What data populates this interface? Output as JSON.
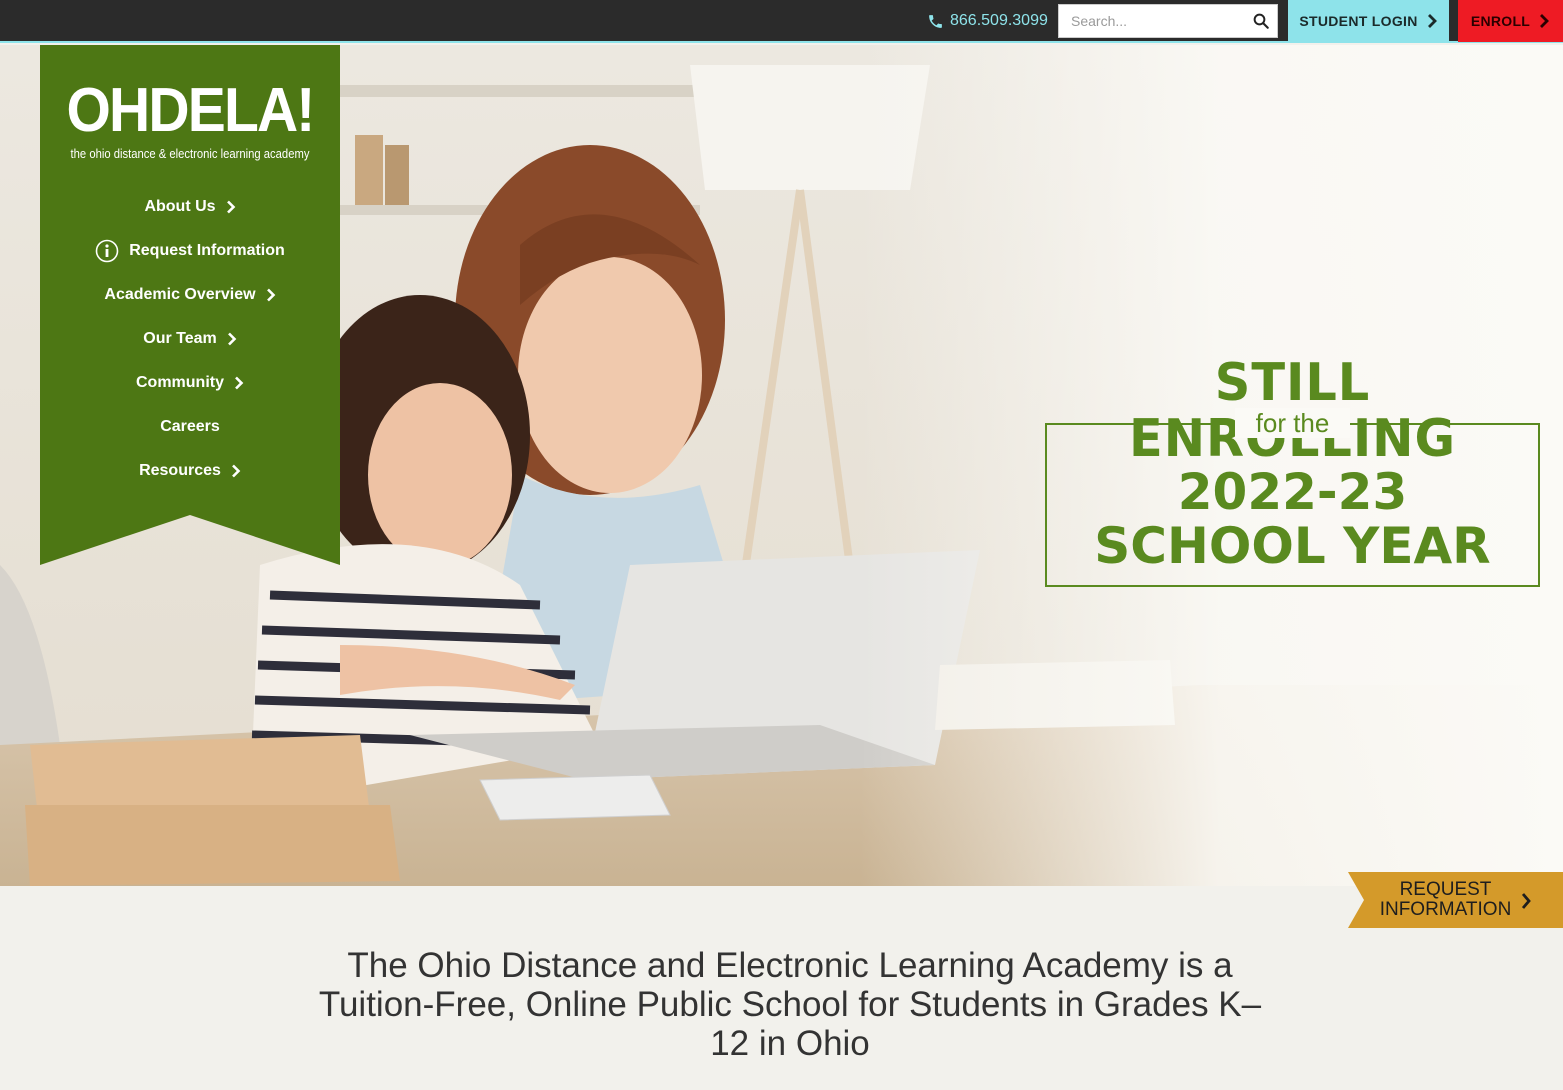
{
  "topbar": {
    "phone": "866.509.3099",
    "search_placeholder": "Search...",
    "student_login": "STUDENT LOGIN",
    "enroll": "ENROLL"
  },
  "logo": {
    "title": "OHDELA!",
    "subtitle": "the ohio distance & electronic learning academy"
  },
  "nav": {
    "items": [
      {
        "label": "About Us"
      },
      {
        "label": "Request Information"
      },
      {
        "label": "Academic Overview"
      },
      {
        "label": "Our Team"
      },
      {
        "label": "Community"
      },
      {
        "label": "Careers"
      },
      {
        "label": "Resources"
      }
    ]
  },
  "hero": {
    "line1": "STILL ENROLLING",
    "line2": "for the",
    "line3": "2022-23",
    "line4": "SCHOOL YEAR"
  },
  "request_tab": {
    "line1": "REQUEST",
    "line2": "INFORMATION"
  },
  "tagline": "The Ohio Distance and Electronic Learning Academy is a Tuition-Free, Online Public School for Students in Grades K–12 in Ohio",
  "colors": {
    "topbar": "#2b2b2b",
    "cyan": "#8ee3ea",
    "red": "#ee1b24",
    "green": "#4d7714",
    "text_green": "#5a8a1f",
    "gold": "#d49a2a"
  }
}
